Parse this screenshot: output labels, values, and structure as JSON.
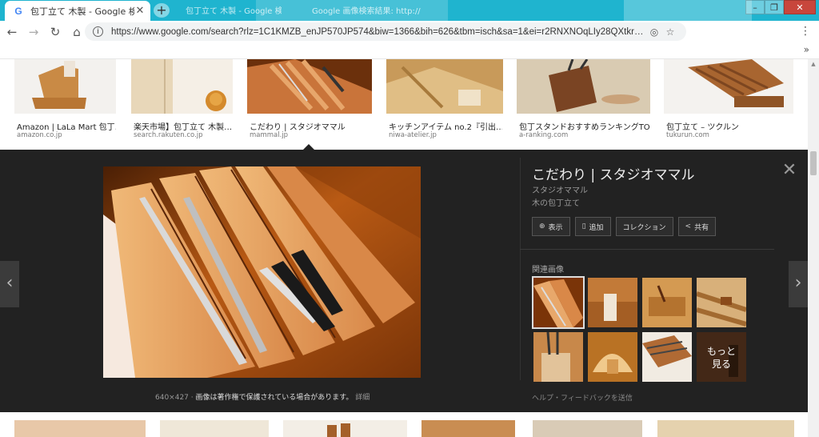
{
  "browser": {
    "active_tab_title": "包丁立て 木製 - Google 検索",
    "bg_tab_1": "包丁立て 木製 - Google 検索",
    "bg_tab_2": "Google 画像検索結果: http://",
    "url": "https://www.google.com/search?rlz=1C1KMZB_enJP570JP574&biw=1366&bih=626&tbm=isch&sa=1&ei=r2RNXNOqLIy28QXtkr…",
    "bookmarks_more": "»"
  },
  "results": [
    {
      "title": "Amazon | LaLa Mart 包丁…",
      "source": "amazon.co.jp"
    },
    {
      "title": "楽天市場】包丁立て 木製…",
      "source": "search.rakuten.co.jp"
    },
    {
      "title": "こだわり | スタジオママル",
      "source": "mammal.jp"
    },
    {
      "title": "キッチンアイテム no.2『引出…",
      "source": "niwa-atelier.jp"
    },
    {
      "title": "包丁スタンドおすすめランキングTO…",
      "source": "a-ranking.com"
    },
    {
      "title": "包丁立て – ツクルン",
      "source": "tukurun.com"
    }
  ],
  "preview": {
    "title": "こだわり | スタジオママル",
    "site": "スタジオママル",
    "description": "木の包丁立て",
    "size": "640×427",
    "notice": "画像は著作権で保護されている場合があります。",
    "details": "詳細",
    "actions": {
      "visit": "表示",
      "save": "追加",
      "collection": "コレクション",
      "share": "共有"
    },
    "related_label": "関連画像",
    "more_line1": "もっと",
    "more_line2": "見る",
    "help": "ヘルプ・フィードバックを送信"
  },
  "colors": {
    "tab_strip": "#1fb4cf",
    "panel_bg": "#222222",
    "wood_light": "#d9a05a",
    "wood_dark": "#8a4a1a"
  }
}
